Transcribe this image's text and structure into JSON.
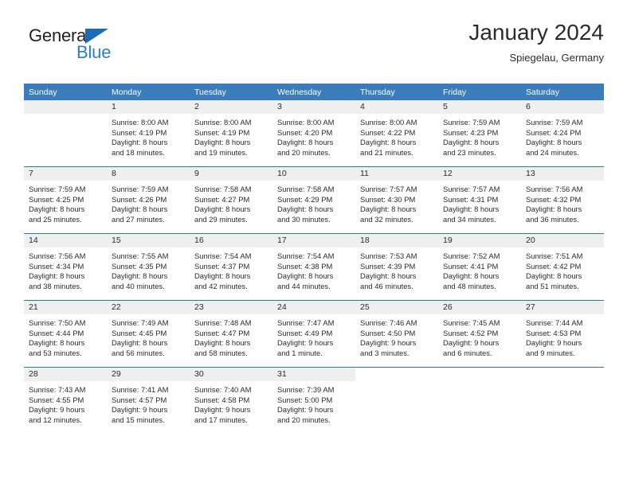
{
  "brand": {
    "name_top": "General",
    "name_bottom": "Blue",
    "triangle_color": "#1b6cb5",
    "blue_text_color": "#2a7dc9",
    "top_text_color": "#231f20"
  },
  "header": {
    "title": "January 2024",
    "subtitle": "Spiegelau, Germany"
  },
  "theme": {
    "header_band": "#3b7cbd",
    "daynum_band": "#efefef",
    "week_divider": "#2e72b0",
    "text": "#2b2b2b"
  },
  "columns": [
    "Sunday",
    "Monday",
    "Tuesday",
    "Wednesday",
    "Thursday",
    "Friday",
    "Saturday"
  ],
  "weeks": [
    [
      {
        "day": "",
        "lines": []
      },
      {
        "day": "1",
        "lines": [
          "Sunrise: 8:00 AM",
          "Sunset: 4:19 PM",
          "Daylight: 8 hours",
          "and 18 minutes."
        ]
      },
      {
        "day": "2",
        "lines": [
          "Sunrise: 8:00 AM",
          "Sunset: 4:19 PM",
          "Daylight: 8 hours",
          "and 19 minutes."
        ]
      },
      {
        "day": "3",
        "lines": [
          "Sunrise: 8:00 AM",
          "Sunset: 4:20 PM",
          "Daylight: 8 hours",
          "and 20 minutes."
        ]
      },
      {
        "day": "4",
        "lines": [
          "Sunrise: 8:00 AM",
          "Sunset: 4:22 PM",
          "Daylight: 8 hours",
          "and 21 minutes."
        ]
      },
      {
        "day": "5",
        "lines": [
          "Sunrise: 7:59 AM",
          "Sunset: 4:23 PM",
          "Daylight: 8 hours",
          "and 23 minutes."
        ]
      },
      {
        "day": "6",
        "lines": [
          "Sunrise: 7:59 AM",
          "Sunset: 4:24 PM",
          "Daylight: 8 hours",
          "and 24 minutes."
        ]
      }
    ],
    [
      {
        "day": "7",
        "lines": [
          "Sunrise: 7:59 AM",
          "Sunset: 4:25 PM",
          "Daylight: 8 hours",
          "and 25 minutes."
        ]
      },
      {
        "day": "8",
        "lines": [
          "Sunrise: 7:59 AM",
          "Sunset: 4:26 PM",
          "Daylight: 8 hours",
          "and 27 minutes."
        ]
      },
      {
        "day": "9",
        "lines": [
          "Sunrise: 7:58 AM",
          "Sunset: 4:27 PM",
          "Daylight: 8 hours",
          "and 29 minutes."
        ]
      },
      {
        "day": "10",
        "lines": [
          "Sunrise: 7:58 AM",
          "Sunset: 4:29 PM",
          "Daylight: 8 hours",
          "and 30 minutes."
        ]
      },
      {
        "day": "11",
        "lines": [
          "Sunrise: 7:57 AM",
          "Sunset: 4:30 PM",
          "Daylight: 8 hours",
          "and 32 minutes."
        ]
      },
      {
        "day": "12",
        "lines": [
          "Sunrise: 7:57 AM",
          "Sunset: 4:31 PM",
          "Daylight: 8 hours",
          "and 34 minutes."
        ]
      },
      {
        "day": "13",
        "lines": [
          "Sunrise: 7:56 AM",
          "Sunset: 4:32 PM",
          "Daylight: 8 hours",
          "and 36 minutes."
        ]
      }
    ],
    [
      {
        "day": "14",
        "lines": [
          "Sunrise: 7:56 AM",
          "Sunset: 4:34 PM",
          "Daylight: 8 hours",
          "and 38 minutes."
        ]
      },
      {
        "day": "15",
        "lines": [
          "Sunrise: 7:55 AM",
          "Sunset: 4:35 PM",
          "Daylight: 8 hours",
          "and 40 minutes."
        ]
      },
      {
        "day": "16",
        "lines": [
          "Sunrise: 7:54 AM",
          "Sunset: 4:37 PM",
          "Daylight: 8 hours",
          "and 42 minutes."
        ]
      },
      {
        "day": "17",
        "lines": [
          "Sunrise: 7:54 AM",
          "Sunset: 4:38 PM",
          "Daylight: 8 hours",
          "and 44 minutes."
        ]
      },
      {
        "day": "18",
        "lines": [
          "Sunrise: 7:53 AM",
          "Sunset: 4:39 PM",
          "Daylight: 8 hours",
          "and 46 minutes."
        ]
      },
      {
        "day": "19",
        "lines": [
          "Sunrise: 7:52 AM",
          "Sunset: 4:41 PM",
          "Daylight: 8 hours",
          "and 48 minutes."
        ]
      },
      {
        "day": "20",
        "lines": [
          "Sunrise: 7:51 AM",
          "Sunset: 4:42 PM",
          "Daylight: 8 hours",
          "and 51 minutes."
        ]
      }
    ],
    [
      {
        "day": "21",
        "lines": [
          "Sunrise: 7:50 AM",
          "Sunset: 4:44 PM",
          "Daylight: 8 hours",
          "and 53 minutes."
        ]
      },
      {
        "day": "22",
        "lines": [
          "Sunrise: 7:49 AM",
          "Sunset: 4:45 PM",
          "Daylight: 8 hours",
          "and 56 minutes."
        ]
      },
      {
        "day": "23",
        "lines": [
          "Sunrise: 7:48 AM",
          "Sunset: 4:47 PM",
          "Daylight: 8 hours",
          "and 58 minutes."
        ]
      },
      {
        "day": "24",
        "lines": [
          "Sunrise: 7:47 AM",
          "Sunset: 4:49 PM",
          "Daylight: 9 hours",
          "and 1 minute."
        ]
      },
      {
        "day": "25",
        "lines": [
          "Sunrise: 7:46 AM",
          "Sunset: 4:50 PM",
          "Daylight: 9 hours",
          "and 3 minutes."
        ]
      },
      {
        "day": "26",
        "lines": [
          "Sunrise: 7:45 AM",
          "Sunset: 4:52 PM",
          "Daylight: 9 hours",
          "and 6 minutes."
        ]
      },
      {
        "day": "27",
        "lines": [
          "Sunrise: 7:44 AM",
          "Sunset: 4:53 PM",
          "Daylight: 9 hours",
          "and 9 minutes."
        ]
      }
    ],
    [
      {
        "day": "28",
        "lines": [
          "Sunrise: 7:43 AM",
          "Sunset: 4:55 PM",
          "Daylight: 9 hours",
          "and 12 minutes."
        ]
      },
      {
        "day": "29",
        "lines": [
          "Sunrise: 7:41 AM",
          "Sunset: 4:57 PM",
          "Daylight: 9 hours",
          "and 15 minutes."
        ]
      },
      {
        "day": "30",
        "lines": [
          "Sunrise: 7:40 AM",
          "Sunset: 4:58 PM",
          "Daylight: 9 hours",
          "and 17 minutes."
        ]
      },
      {
        "day": "31",
        "lines": [
          "Sunrise: 7:39 AM",
          "Sunset: 5:00 PM",
          "Daylight: 9 hours",
          "and 20 minutes."
        ]
      },
      {
        "day": "",
        "lines": []
      },
      {
        "day": "",
        "lines": []
      },
      {
        "day": "",
        "lines": []
      }
    ]
  ]
}
